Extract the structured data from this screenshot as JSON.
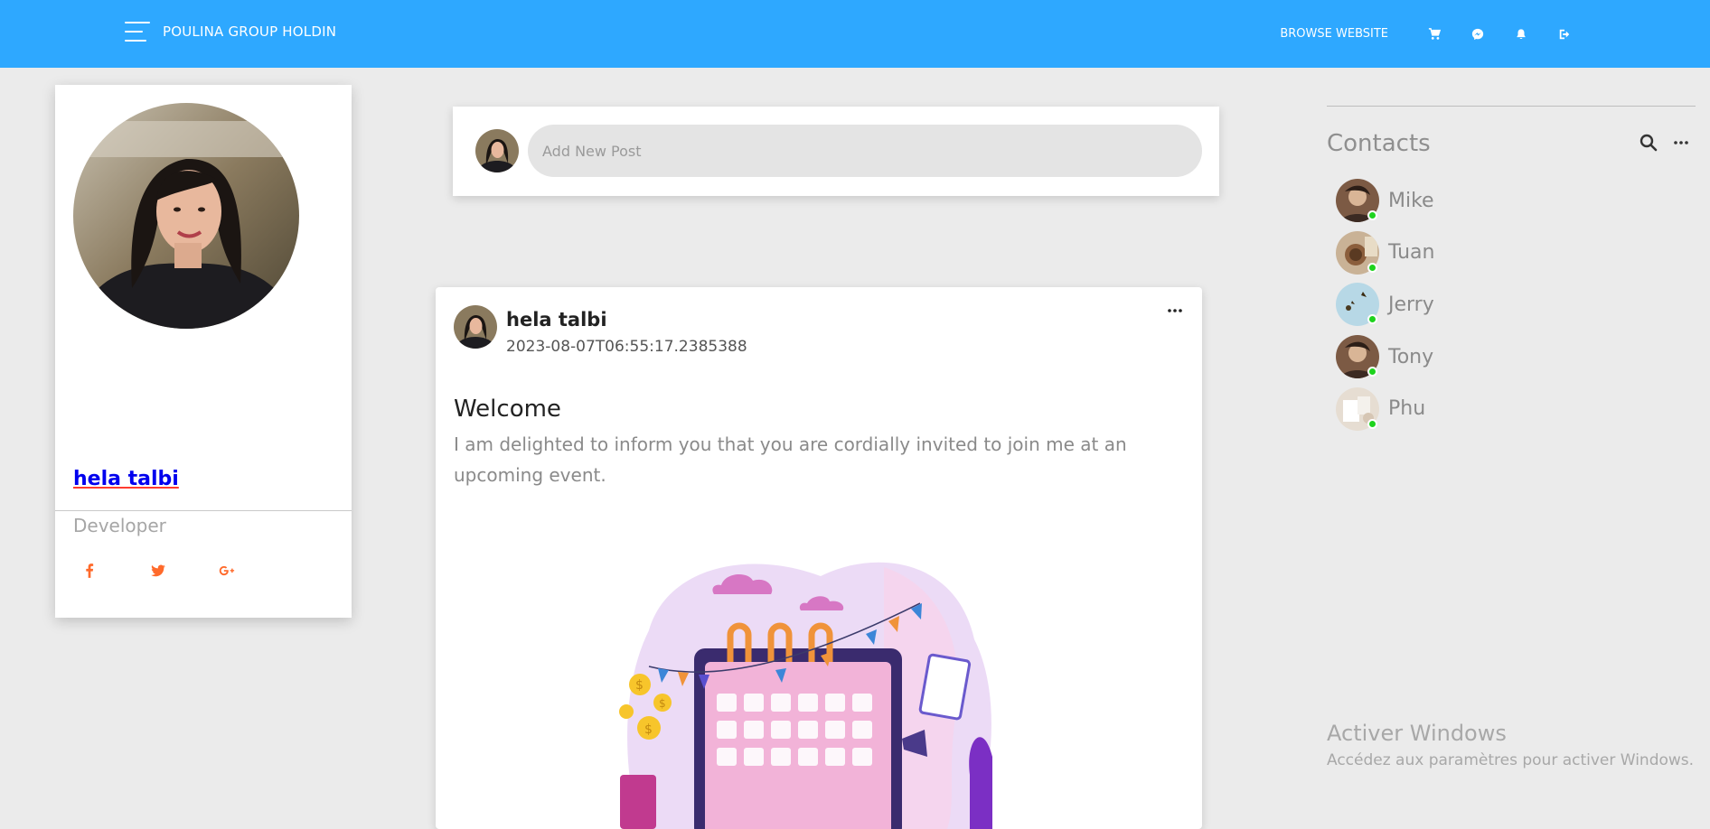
{
  "navbar": {
    "brand": "POULINA GROUP HOLDIN",
    "browse_label": "BROWSE WEBSITE",
    "icons": [
      "cart-icon",
      "messenger-icon",
      "bell-icon",
      "logout-icon"
    ],
    "background": "#2ea8ff"
  },
  "profile": {
    "name": "hela talbi",
    "role": "Developer",
    "social_icons": [
      "facebook-icon",
      "twitter-icon",
      "google-plus-icon"
    ],
    "social_color": "#ff6a2b"
  },
  "new_post": {
    "placeholder": "Add New Post"
  },
  "post": {
    "author": "hela talbi",
    "date": "2023-08-07T06:55:17.2385388",
    "title": "Welcome",
    "body": "I am delighted to inform you that you are cordially invited to join me at an upcoming event."
  },
  "contacts": {
    "title": "Contacts",
    "items": [
      {
        "name": "Mike",
        "online": true
      },
      {
        "name": "Tuan",
        "online": true
      },
      {
        "name": "Jerry",
        "online": true
      },
      {
        "name": "Tony",
        "online": true
      },
      {
        "name": "Phu",
        "online": true
      }
    ]
  },
  "watermark": {
    "title": "Activer Windows",
    "subtitle": "Accédez aux paramètres pour activer Windows."
  }
}
